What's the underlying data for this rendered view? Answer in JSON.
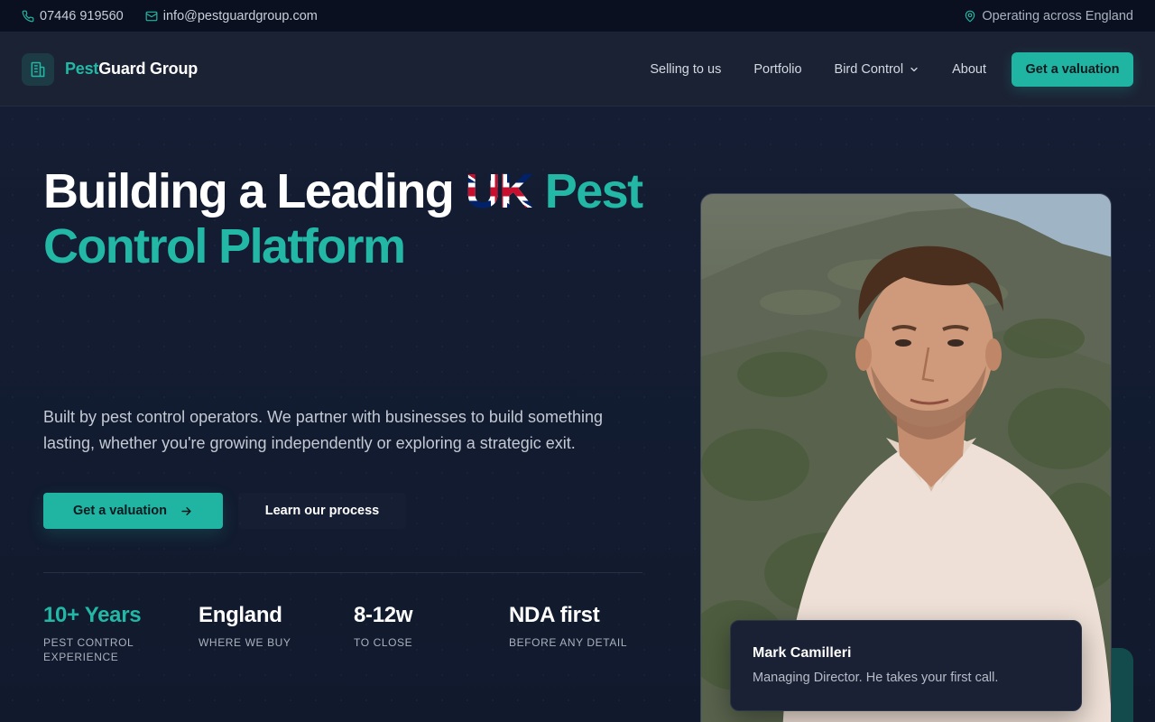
{
  "topbar": {
    "phone": "07446 919560",
    "email": "info@pestguardgroup.com",
    "location": "Operating across England"
  },
  "nav": {
    "logo_part1": "Pest",
    "logo_part2": "Guard Group",
    "items": [
      {
        "label": "Selling to us"
      },
      {
        "label": "Portfolio"
      },
      {
        "label": "Bird Control"
      },
      {
        "label": "About"
      }
    ],
    "cta": "Get a valuation"
  },
  "hero": {
    "headline_part1": "Building a Leading ",
    "headline_flag_word": "UK",
    "headline_part2": " Pest Control Platform",
    "subtitle": "Built by pest control operators. We partner with businesses to build something lasting, whether you're growing independently or exploring a strategic exit.",
    "primary_cta": "Get a valuation",
    "secondary_cta": "Learn our process",
    "stats": [
      {
        "value": "10+ Years",
        "label": "PEST CONTROL EXPERIENCE"
      },
      {
        "value": "England",
        "label": "WHERE WE BUY"
      },
      {
        "value": "8-12w",
        "label": "TO CLOSE"
      },
      {
        "value": "NDA first",
        "label": "BEFORE ANY DETAIL"
      }
    ]
  },
  "profile": {
    "name": "Mark Camilleri",
    "role": "Managing Director. He takes your first call."
  },
  "colors": {
    "accent": "#1fb5a2",
    "background": "#111a2e",
    "topbar": "#0a1020",
    "nav": "#1b2234"
  },
  "icons": [
    "phone-icon",
    "mail-icon",
    "map-pin-icon",
    "building-icon",
    "chevron-down-icon",
    "arrow-right-icon"
  ]
}
